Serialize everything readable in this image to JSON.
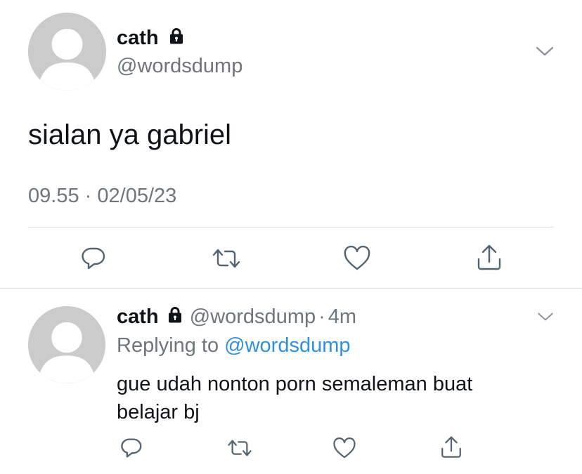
{
  "main_tweet": {
    "display_name": "cath",
    "handle": "@wordsdump",
    "text": "sialan ya gabriel",
    "time": "09.55",
    "separator": "·",
    "date": "02/05/23"
  },
  "reply": {
    "display_name": "cath",
    "handle": "@wordsdump",
    "separator": "·",
    "age": "4m",
    "replying_prefix": "Replying to",
    "replying_to": "@wordsdump",
    "text_line1": "gue udah nonton porn semaleman buat",
    "text_line2": "belajar bj"
  },
  "icons": {
    "lock": "lock-icon",
    "chevron": "chevron-down-icon",
    "reply": "reply-icon",
    "retweet": "retweet-icon",
    "like": "heart-icon",
    "share": "share-icon"
  },
  "colors": {
    "text": "#0f1419",
    "muted": "#6e767d",
    "link": "#2f8fe0",
    "divider": "#dcdfe2",
    "avatar": "#cbcbcb"
  }
}
